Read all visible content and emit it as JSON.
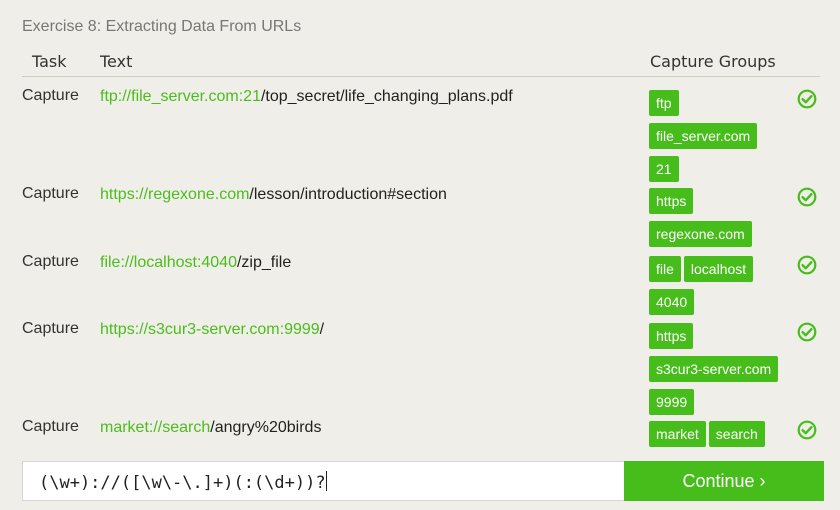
{
  "exercise_title": "Exercise 8: Extracting Data From URLs",
  "columns": {
    "task": "Task",
    "text": "Text",
    "capture": "Capture Groups"
  },
  "rows": [
    {
      "task": "Capture",
      "match": "ftp://file_server.com:21",
      "rest": "/top_secret/life_changing_plans.pdf",
      "groups": [
        "ftp",
        "file_server.com",
        "21"
      ],
      "status": "check-circle-icon"
    },
    {
      "task": "Capture",
      "match": "https://regexone.com",
      "rest": "/lesson/introduction#section",
      "groups": [
        "https",
        "regexone.com"
      ],
      "status": "check-circle-icon"
    },
    {
      "task": "Capture",
      "match": "file://localhost:4040",
      "rest": "/zip_file",
      "groups": [
        "file",
        "localhost",
        "4040"
      ],
      "status": "check-circle-icon"
    },
    {
      "task": "Capture",
      "match": "https://s3cur3-server.com:9999",
      "rest": "/",
      "groups": [
        "https",
        "s3cur3-server.com",
        "9999"
      ],
      "status": "check-circle-icon"
    },
    {
      "task": "Capture",
      "match": "market://search",
      "rest": "/angry%20birds",
      "groups": [
        "market",
        "search"
      ],
      "status": "check-circle-icon"
    }
  ],
  "regex_input": {
    "value": "(\\w+)://([\\w\\-\\.]+)(:(\\d+))?"
  },
  "continue_button": {
    "label": "Continue ›"
  },
  "colors": {
    "accent": "#47bd1b",
    "match_text": "#4cbd1c",
    "background": "#efeee8"
  }
}
